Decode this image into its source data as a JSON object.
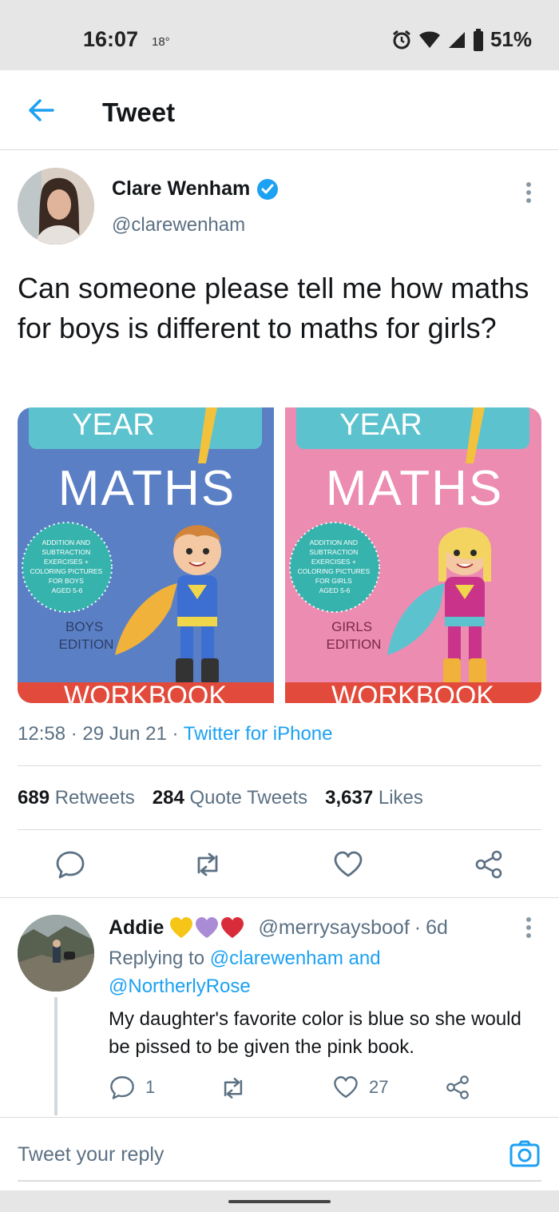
{
  "status_bar": {
    "time": "16:07",
    "temperature": "18°",
    "battery_percent": "51%"
  },
  "header": {
    "title": "Tweet"
  },
  "tweet": {
    "author_name": "Clare Wenham",
    "author_handle": "@clarewenham",
    "verified": true,
    "text": "Can someone please tell me how maths for boys is different to maths for girls?",
    "media": [
      {
        "year_label": "YEAR",
        "title": "MATHS",
        "badge_lines": [
          "ADDITION AND",
          "SUBTRACTION",
          "EXERCISES +",
          "COLORING PICTURES",
          "FOR BOYS",
          "AGED 5-6"
        ],
        "edition_lines": [
          "BOYS",
          "EDITION"
        ],
        "footer": "WORKBOOK",
        "bg_color": "#5a7fc4"
      },
      {
        "year_label": "YEAR",
        "title": "MATHS",
        "badge_lines": [
          "ADDITION AND",
          "SUBTRACTION",
          "EXERCISES +",
          "COLORING PICTURES",
          "FOR GIRLS",
          "AGED 5-6"
        ],
        "edition_lines": [
          "GIRLS",
          "EDITION"
        ],
        "footer": "WORKBOOK",
        "bg_color": "#ec8cb0"
      }
    ],
    "time": "12:58",
    "date": "29 Jun 21",
    "source": "Twitter for iPhone",
    "retweets_count": "689",
    "retweets_label": "Retweets",
    "quote_count": "284",
    "quote_label": "Quote Tweets",
    "likes_count": "3,637",
    "likes_label": "Likes"
  },
  "reply": {
    "name": "Addie",
    "handle": "@merrysaysboof",
    "age": "6d",
    "replying_prefix": "Replying to",
    "replying_to_1": "@clarewenham",
    "replying_and": "and",
    "replying_to_2": "@NortherlyRose",
    "text": "My daughter's favorite color is blue so she would be pissed to be given the pink book.",
    "reply_count": "1",
    "like_count": "27"
  },
  "composer": {
    "placeholder": "Tweet your reply"
  },
  "colors": {
    "accent": "#1da1f2",
    "secondary_text": "#5b7083",
    "heart_yellow": "#f5c518",
    "heart_purple": "#a98bd6",
    "heart_red": "#d92c3a"
  }
}
